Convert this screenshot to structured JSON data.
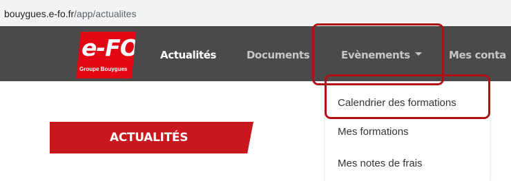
{
  "browser": {
    "url_host": "bouygues.e-fo.fr",
    "url_path": "/app/actualites"
  },
  "logo": {
    "main": "e-FO",
    "sub": "Groupe Bouygues"
  },
  "nav": {
    "items": [
      {
        "label": "Actualités",
        "active": true
      },
      {
        "label": "Documents"
      },
      {
        "label": "Evènements",
        "has_dropdown": true,
        "open": true
      },
      {
        "label": "Mes conta"
      }
    ]
  },
  "dropdown": {
    "items": [
      {
        "label": "Calendrier des formations",
        "highlighted": true
      },
      {
        "label": "Mes formations"
      },
      {
        "label": "Mes notes de frais"
      }
    ]
  },
  "page": {
    "heading": "ACTUALITÉS"
  },
  "colors": {
    "brand_red": "#e30613",
    "heading_red": "#c8171e",
    "navbar_bg": "#4a4a4a",
    "annotation_red": "#b10f16"
  }
}
